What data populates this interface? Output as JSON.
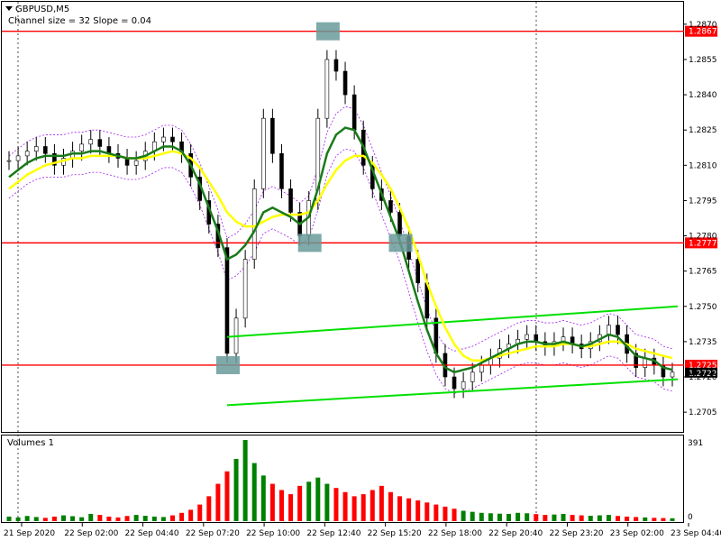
{
  "header": {
    "symbol": "GBPUSD,M5",
    "indicator_note": "Channel size = 32 Slope = 0.04"
  },
  "volume_panel": {
    "title": "Volumes 1",
    "max_label": "391",
    "zero_label": "0"
  },
  "colors": {
    "up_volume": "#008000",
    "down_volume": "#ff0000",
    "ma_fast": "#1a7a1a",
    "ma_slow": "#ffff00",
    "channel": "#00e000",
    "level": "#ff0000",
    "envelope": "#a020f0",
    "marker": "#6a9a9a",
    "candle": "#000000",
    "level_label_bg": "#ff0000"
  },
  "chart_data": {
    "type": "line",
    "symbol": "GBPUSD",
    "timeframe": "M5",
    "ylim": [
      1.2697,
      1.2878
    ],
    "y_ticks": [
      "1.2870",
      "1.2855",
      "1.2840",
      "1.2825",
      "1.2810",
      "1.2795",
      "1.2780",
      "1.2765",
      "1.2750",
      "1.2735",
      "1.2720",
      "1.2705"
    ],
    "x_ticks": [
      "21 Sep 2020",
      "22 Sep 02:00",
      "22 Sep 04:40",
      "22 Sep 07:20",
      "22 Sep 10:00",
      "22 Sep 12:40",
      "22 Sep 15:20",
      "22 Sep 18:00",
      "22 Sep 20:40",
      "22 Sep 23:20",
      "23 Sep 02:00",
      "23 Sep 04:40"
    ],
    "horizontal_levels": [
      {
        "value": 1.2867,
        "label": "1.2867"
      },
      {
        "value": 1.2777,
        "label": "1.2777"
      },
      {
        "value": 1.2725,
        "label": "1.2725"
      }
    ],
    "current_price_label": "1.2722",
    "price_series": {
      "name": "Close",
      "values": [
        1.2812,
        1.2814,
        1.2816,
        1.2818,
        1.2815,
        1.281,
        1.2813,
        1.2816,
        1.2819,
        1.2821,
        1.2818,
        1.2815,
        1.2813,
        1.281,
        1.2812,
        1.2816,
        1.282,
        1.2822,
        1.282,
        1.2815,
        1.2805,
        1.2795,
        1.2785,
        1.2775,
        1.273,
        1.2745,
        1.277,
        1.28,
        1.283,
        1.2815,
        1.28,
        1.279,
        1.278,
        1.2795,
        1.283,
        1.2855,
        1.285,
        1.284,
        1.2825,
        1.281,
        1.28,
        1.2795,
        1.279,
        1.278,
        1.277,
        1.276,
        1.2745,
        1.273,
        1.272,
        1.2715,
        1.2718,
        1.2722,
        1.2725,
        1.2728,
        1.2732,
        1.2734,
        1.2736,
        1.2738,
        1.2735,
        1.2733,
        1.2735,
        1.2737,
        1.2734,
        1.2732,
        1.2735,
        1.2738,
        1.2742,
        1.2738,
        1.273,
        1.2724,
        1.2728,
        1.2725,
        1.272,
        1.2722
      ]
    },
    "ma_fast_series": {
      "values": [
        1.2805,
        1.2808,
        1.2811,
        1.2813,
        1.2814,
        1.2814,
        1.2814,
        1.2815,
        1.2815,
        1.2816,
        1.2816,
        1.2815,
        1.2814,
        1.2813,
        1.2813,
        1.2814,
        1.2816,
        1.2818,
        1.2818,
        1.2816,
        1.281,
        1.2802,
        1.2792,
        1.2782,
        1.277,
        1.2772,
        1.2776,
        1.2782,
        1.279,
        1.2792,
        1.279,
        1.2788,
        1.2785,
        1.2788,
        1.28,
        1.2815,
        1.2823,
        1.2826,
        1.2825,
        1.2818,
        1.2808,
        1.2798,
        1.2788,
        1.2778,
        1.2765,
        1.2752,
        1.274,
        1.273,
        1.2724,
        1.2722,
        1.2723,
        1.2724,
        1.2726,
        1.2728,
        1.273,
        1.2732,
        1.2734,
        1.2735,
        1.2735,
        1.2734,
        1.2734,
        1.2735,
        1.2734,
        1.2733,
        1.2734,
        1.2736,
        1.2738,
        1.2737,
        1.2733,
        1.2729,
        1.2728,
        1.2727,
        1.2724,
        1.2723
      ]
    },
    "ma_slow_series": {
      "values": [
        1.28,
        1.2803,
        1.2806,
        1.2808,
        1.281,
        1.2811,
        1.2812,
        1.2813,
        1.2813,
        1.2814,
        1.2814,
        1.2814,
        1.2814,
        1.2813,
        1.2813,
        1.2813,
        1.2814,
        1.2815,
        1.2816,
        1.2815,
        1.2813,
        1.2809,
        1.2803,
        1.2797,
        1.279,
        1.2786,
        1.2784,
        1.2784,
        1.2786,
        1.2788,
        1.2789,
        1.2789,
        1.2789,
        1.279,
        1.2795,
        1.2802,
        1.2808,
        1.2812,
        1.2814,
        1.2814,
        1.2811,
        1.2806,
        1.28,
        1.2792,
        1.2783,
        1.2772,
        1.276,
        1.275,
        1.2741,
        1.2734,
        1.2729,
        1.2727,
        1.2727,
        1.2728,
        1.2729,
        1.273,
        1.2731,
        1.2732,
        1.2733,
        1.2733,
        1.2733,
        1.2734,
        1.2734,
        1.2733,
        1.2733,
        1.2734,
        1.2735,
        1.2735,
        1.2734,
        1.2732,
        1.2731,
        1.273,
        1.2729,
        1.2728
      ]
    },
    "channel_upper": {
      "from": 1.2737,
      "to": 1.275
    },
    "channel_lower": {
      "from": 1.2708,
      "to": 1.2719
    },
    "signal_markers": [
      {
        "index": 24,
        "value": 1.2725
      },
      {
        "index": 33,
        "value": 1.2777
      },
      {
        "index": 35,
        "value": 1.2867
      },
      {
        "index": 43,
        "value": 1.2777
      }
    ],
    "volumes": [
      22,
      18,
      25,
      20,
      16,
      22,
      28,
      24,
      19,
      35,
      30,
      22,
      18,
      25,
      30,
      26,
      22,
      20,
      28,
      40,
      55,
      80,
      120,
      180,
      240,
      300,
      391,
      280,
      220,
      180,
      150,
      130,
      170,
      190,
      210,
      180,
      160,
      140,
      120,
      130,
      150,
      170,
      140,
      120,
      110,
      100,
      90,
      80,
      70,
      60,
      50,
      45,
      40,
      38,
      36,
      35,
      40,
      38,
      34,
      30,
      32,
      35,
      30,
      28,
      26,
      28,
      30,
      25,
      22,
      20,
      18,
      16,
      15,
      14
    ],
    "volume_ylim": [
      0,
      391
    ]
  }
}
